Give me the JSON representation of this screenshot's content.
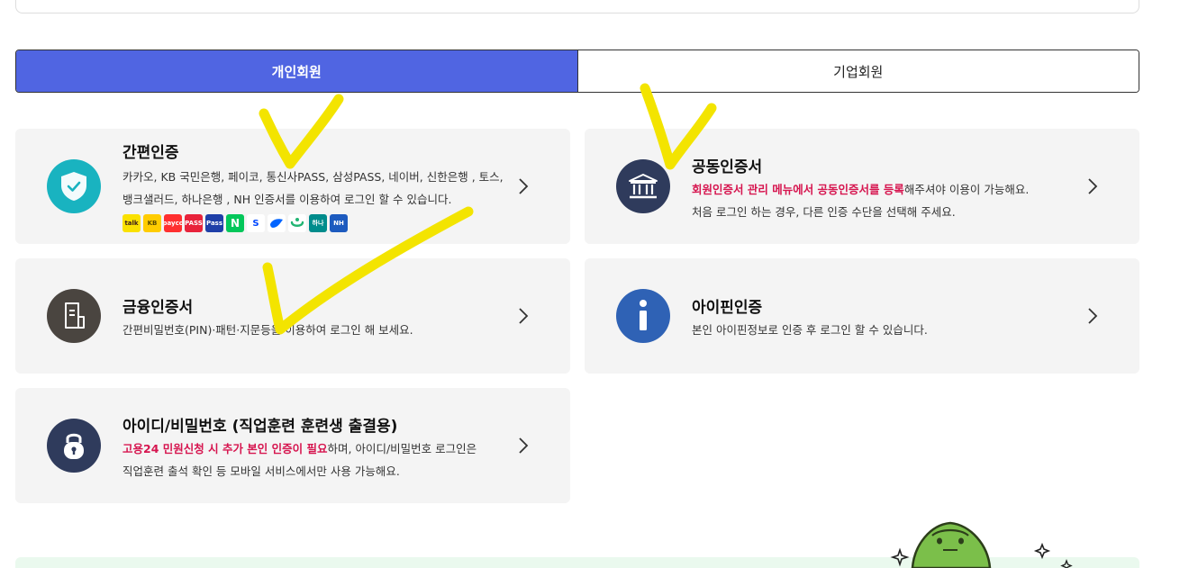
{
  "tabs": [
    {
      "label": "개인회원",
      "active": true
    },
    {
      "label": "기업회원",
      "active": false
    }
  ],
  "cards": {
    "simple": {
      "title": "간편인증",
      "desc_line1": "카카오, KB 국민은행, 페이코, 통신사PASS, 삼성PASS, 네이버, 신한은행 , 토스,",
      "desc_line2": "뱅크샐러드, 하나은행 , NH 인증서를 이용하여 로그인 할 수 있습니다.",
      "apps": [
        {
          "name": "kakao",
          "text": "talk",
          "bg": "#fae100",
          "fg": "#3a1d1d"
        },
        {
          "name": "kb",
          "text": "KB",
          "bg": "#ffcc00",
          "fg": "#5a4b00"
        },
        {
          "name": "payco",
          "text": "payco",
          "bg": "#ff2f2f",
          "fg": "#ffffff"
        },
        {
          "name": "pass",
          "text": "PASS",
          "bg": "#e8233b",
          "fg": "#ffffff"
        },
        {
          "name": "samsung-pass",
          "text": "Pass",
          "bg": "#1f3fa8",
          "fg": "#ffffff"
        },
        {
          "name": "naver",
          "text": "N",
          "bg": "#03c75a",
          "fg": "#ffffff"
        },
        {
          "name": "shinhan",
          "text": "S",
          "bg": "#ffffff",
          "fg": "#0046ff"
        },
        {
          "name": "toss",
          "text": "",
          "bg": "#ffffff",
          "fg": "#0064ff"
        },
        {
          "name": "banksalad",
          "text": "",
          "bg": "#ffffff",
          "fg": "#22b573"
        },
        {
          "name": "hana",
          "text": "하나",
          "bg": "#008c8c",
          "fg": "#ffffff"
        },
        {
          "name": "nh",
          "text": "NH",
          "bg": "#1d5bbf",
          "fg": "#ffffff"
        }
      ]
    },
    "joint": {
      "title": "공동인증서",
      "desc_hl": "회원인증서 관리 메뉴에서 공동인증서를 등록",
      "desc_rest": "해주셔야 이용이 가능해요.",
      "desc_line2": "처음 로그인 하는 경우, 다른 인증 수단을 선택해 주세요."
    },
    "financial": {
      "title": "금융인증서",
      "desc": "간편비밀번호(PIN)·패턴·지문등을 이용하여 로그인 해 보세요."
    },
    "ipin": {
      "title": "아이핀인증",
      "desc": "본인 아이핀정보로 인증 후 로그인 할 수 있습니다."
    },
    "idpw": {
      "title": "아이디/비밀번호 (직업훈련 훈련생 출결용)",
      "desc_hl": "고용24 민원신청 시 추가 본인 인증이 필요",
      "desc_rest": "하며, 아이디/비밀번호 로그인은",
      "desc_line2": "직업훈련 출석 확인 등 모바일 서비스에서만 사용 가능해요."
    }
  },
  "colors": {
    "accent": "#5065e2",
    "highlight": "#d6154f",
    "teal": "#19b3c0",
    "navy": "#2f3b5c",
    "darkgray": "#4a4540",
    "ipin": "#2f62b5",
    "annotation": "#f3e400"
  }
}
